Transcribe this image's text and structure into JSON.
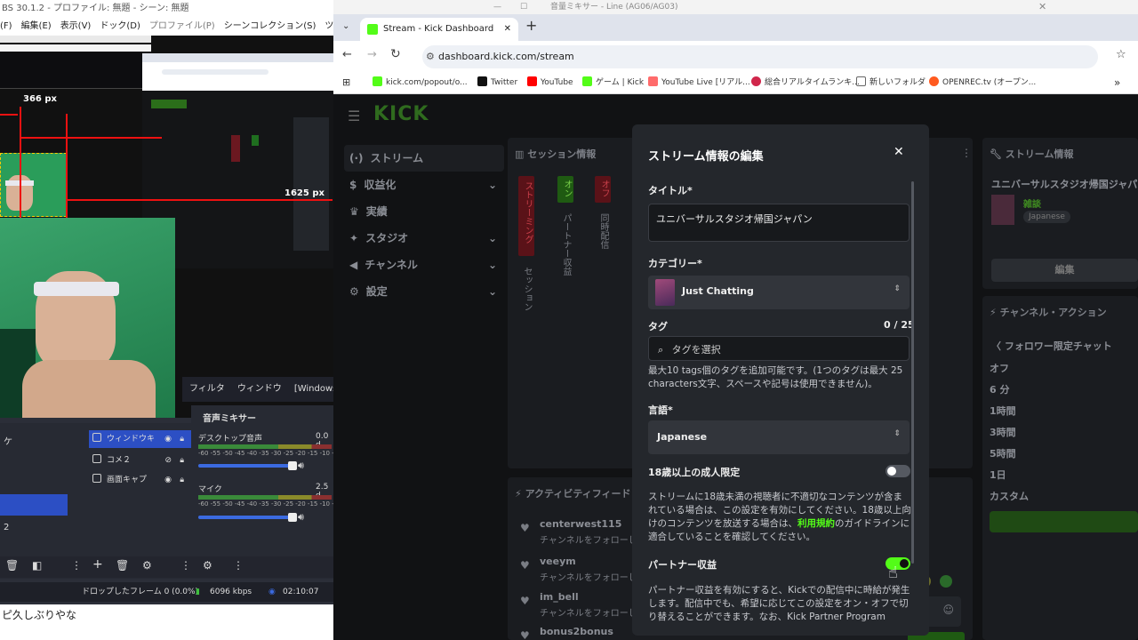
{
  "obs": {
    "title": "BS 30.1.2 - プロファイル: 無題 - シーン: 無題",
    "menu": [
      "(F)",
      "編集(E)",
      "表示(V)",
      "ドック(D)",
      "プロファイル(P)",
      "シーンコレクション(S)",
      "ツール(T)",
      "ヘル"
    ],
    "preview": {
      "width_label": "366 px",
      "width_label2": "1625 px"
    },
    "dock_tabs": [
      "フィルタ",
      "ウィンドウ",
      "[Windows("
    ],
    "sources": [
      {
        "label": "ウィンドウキ",
        "selected": true
      },
      {
        "label": "コメ２",
        "selected": false
      },
      {
        "label": "画面キャプ",
        "selected": false
      }
    ],
    "left_labels": [
      "ケ",
      "2"
    ],
    "mixer": {
      "title": "音声ミキサー",
      "tracks": [
        {
          "name": "デスクトップ音声",
          "db": "0.0 d"
        },
        {
          "name": "マイク",
          "db": "2.5 d"
        }
      ],
      "scale": "-60 -55 -50 -45 -40 -35 -30 -25 -20 -15 -10 -5"
    },
    "status": {
      "dropped": "ドロップしたフレーム 0 (0.0%)",
      "bitrate": "6096 kbps",
      "time": "02:10:07"
    },
    "chat_line": "ピ久しぶりやな"
  },
  "browser": {
    "top_window_title": "音量ミキサー - Line (AG06/AG03)",
    "tab_title": "Stream - Kick Dashboard",
    "url": "dashboard.kick.com/stream",
    "bookmarks": [
      {
        "label": "kick.com/popout/o...",
        "color": "#53fc18"
      },
      {
        "label": "Twitter",
        "color": "#111111"
      },
      {
        "label": "YouTube",
        "color": "#ff0000"
      },
      {
        "label": "ゲーム | Kick",
        "color": "#53fc18"
      },
      {
        "label": "YouTube Live [リアル...",
        "color": "#ff6b6b"
      },
      {
        "label": "総合リアルタイムランキ...",
        "color": "#d0264b"
      },
      {
        "label": "新しいフォルダ",
        "color": "#666666"
      },
      {
        "label": "OPENREC.tv (オープン...",
        "color": "#ff5a1f"
      }
    ]
  },
  "kick": {
    "logo": "KICK",
    "nav": [
      {
        "label": "ストリーム",
        "icon": "broadcast-icon",
        "active": true
      },
      {
        "label": "収益化",
        "icon": "dollar-icon",
        "active": false
      },
      {
        "label": "実績",
        "icon": "trophy-icon",
        "active": false
      },
      {
        "label": "スタジオ",
        "icon": "wand-icon",
        "active": false
      },
      {
        "label": "チャンネル",
        "icon": "megaphone-icon",
        "active": false
      },
      {
        "label": "設定",
        "icon": "gear-icon",
        "active": false
      }
    ],
    "session": {
      "title": "セッション情報",
      "streaming": "ストリーミング",
      "on": "オン",
      "off": "オフ",
      "session_col": "セッション",
      "partner_col": "パートナー収益",
      "simul_col": "同時配信"
    },
    "stream_info": {
      "title": "ストリーム情報",
      "stream_title": "ユニバーサルスタジオ帰国ジャパン",
      "category": "雑談",
      "language": "Japanese",
      "edit_button": "編集"
    },
    "channel_actions": {
      "title": "チャンネル・アクション",
      "follower_chat": "フォロワー限定チャット",
      "options": [
        "オフ",
        "6 分",
        "1時間",
        "3時間",
        "5時間",
        "1日",
        "カスタム"
      ]
    },
    "activity": {
      "title": "アクティビティフィード",
      "items": [
        {
          "name": "centerwest115",
          "text": "チャンネルをフォローし"
        },
        {
          "name": "veeym",
          "text": "チャンネルをフォローし"
        },
        {
          "name": "im_bell",
          "text": "チャンネルをフォローし"
        },
        {
          "name": "bonus2bonus",
          "text": ""
        }
      ]
    }
  },
  "modal": {
    "title": "ストリーム情報の編集",
    "title_label": "タイトル*",
    "title_value": "ユニバーサルスタジオ帰国ジャパン",
    "category_label": "カテゴリー*",
    "category_value": "Just Chatting",
    "tags_label": "タグ",
    "tags_count": "0 / 25",
    "tags_placeholder": "タグを選択",
    "tags_help": "最大10 tags個のタグを追加可能です。(1つのタグは最大 25 characters文字、スペースや記号は使用できません)。",
    "language_label": "言語*",
    "language_value": "Japanese",
    "adult_label": "18歳以上の成人限定",
    "adult_on": false,
    "adult_help_1": "ストリームに18歳未満の視聴者に不適切なコンテンツが含まれている場合は、この設定を有効にしてください。18歳以上向けのコンテンツを放送する場合は、",
    "adult_help_link": "利用規約",
    "adult_help_2": "のガイドラインに適合していることを確認してください。",
    "partner_label": "パートナー収益",
    "partner_on": true,
    "partner_help": "パートナー収益を有効にすると、Kickでの配信中に時給が発生します。配信中でも、希望に応じてこの設定をオン・オフで切り替えることができます。なお、Kick Partner Program"
  },
  "colors": {
    "kick_green": "#53fc18",
    "obs_blue": "#2c4fc4",
    "streaming_red": "#c1121f"
  }
}
